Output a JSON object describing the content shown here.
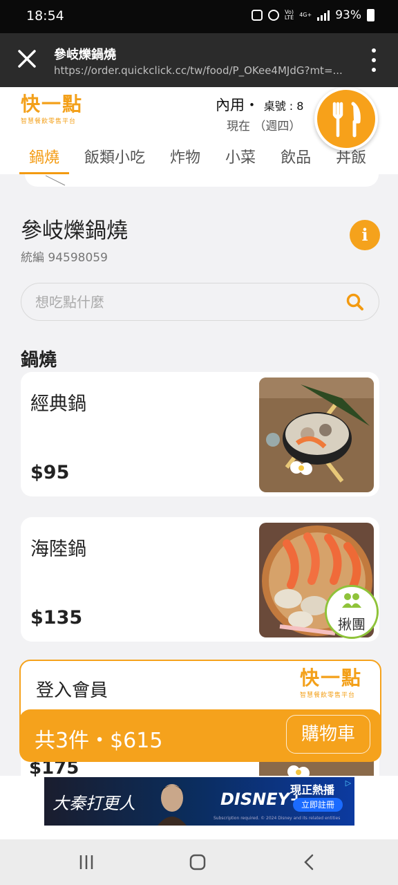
{
  "status_bar": {
    "time": "18:54",
    "network": "4G+",
    "battery": "93%"
  },
  "browser": {
    "title": "參岐爍鍋燒",
    "url": "https://order.quickclick.cc/tw/food/P_OKee4MJdG?mt=..."
  },
  "brand": {
    "logo_text": "快一點",
    "logo_subtitle": "智慧餐飲零售平台"
  },
  "order_info": {
    "dine_mode": "內用・",
    "table": "桌號 : 8",
    "time_label": "現在 （週四）"
  },
  "tabs": [
    "鍋燒",
    "飯類小吃",
    "炸物",
    "小菜",
    "飲品",
    "丼飯"
  ],
  "store": {
    "name": "參岐爍鍋燒",
    "tax_id": "統編 94598059",
    "info_glyph": "i"
  },
  "search": {
    "placeholder": "想吃點什麼"
  },
  "section": {
    "title": "鍋燒"
  },
  "items": [
    {
      "name": "經典鍋",
      "price": "$95"
    },
    {
      "name": "海陸鍋",
      "price": "$135"
    },
    {
      "name": "",
      "price": "$175"
    }
  ],
  "group_order": {
    "label": "揪團"
  },
  "login": {
    "label": "登入會員"
  },
  "cart": {
    "summary": "共3件・$615",
    "button": "購物車"
  },
  "ad": {
    "title": "大秦打更人",
    "brand": "DISNEY+",
    "headline": "現正熱播",
    "cta": "立即註冊",
    "fine_print": "Subscription required. © 2024 Disney and its related entities"
  },
  "colors": {
    "accent": "#f5a21c",
    "group_green": "#8fc33a",
    "header_dark": "#2b2b2b"
  }
}
